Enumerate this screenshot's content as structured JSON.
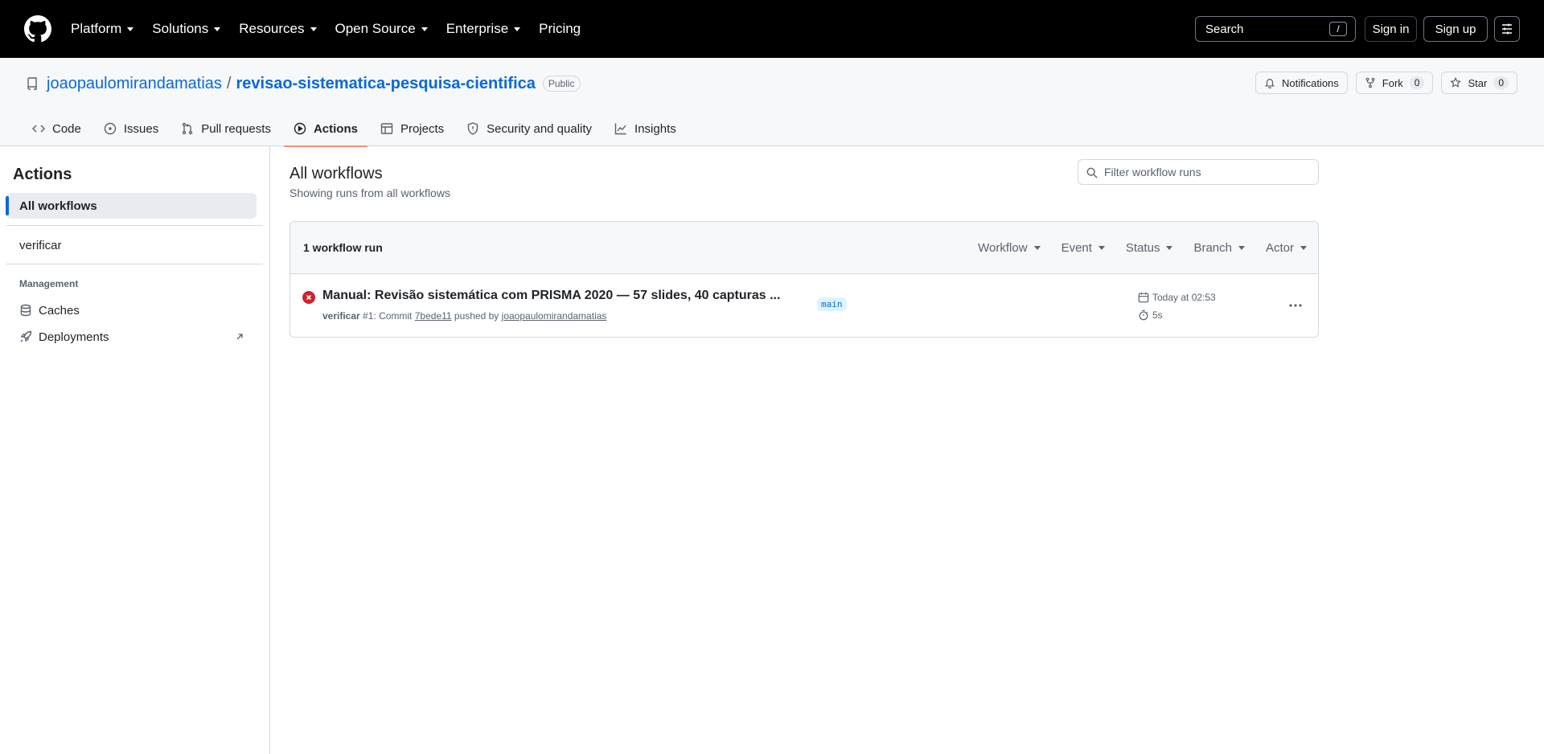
{
  "header": {
    "nav": [
      {
        "label": "Platform"
      },
      {
        "label": "Solutions"
      },
      {
        "label": "Resources"
      },
      {
        "label": "Open Source"
      },
      {
        "label": "Enterprise"
      },
      {
        "label": "Pricing"
      }
    ],
    "search_label": "Search",
    "search_shortcut": "/",
    "sign_in": "Sign in",
    "sign_up": "Sign up"
  },
  "repo": {
    "owner": "joaopaulomirandamatias",
    "separator": "/",
    "name": "revisao-sistematica-pesquisa-cientifica",
    "visibility": "Public",
    "notifications_label": "Notifications",
    "fork_label": "Fork",
    "fork_count": "0",
    "star_label": "Star",
    "star_count": "0",
    "tabs": [
      {
        "label": "Code",
        "icon": "code-icon"
      },
      {
        "label": "Issues",
        "icon": "issue-icon"
      },
      {
        "label": "Pull requests",
        "icon": "pull-request-icon"
      },
      {
        "label": "Actions",
        "icon": "play-icon",
        "selected": true
      },
      {
        "label": "Projects",
        "icon": "table-icon"
      },
      {
        "label": "Security and quality",
        "icon": "shield-icon"
      },
      {
        "label": "Insights",
        "icon": "graph-icon"
      }
    ]
  },
  "sidebar": {
    "title": "Actions",
    "all_workflows": "All workflows",
    "workflows": [
      "verificar"
    ],
    "management_heading": "Management",
    "caches": "Caches",
    "deployments": "Deployments"
  },
  "main": {
    "title": "All workflows",
    "subtitle": "Showing runs from all workflows",
    "filter_placeholder": "Filter workflow runs",
    "runs_count": "1 workflow run",
    "filters": [
      "Workflow",
      "Event",
      "Status",
      "Branch",
      "Actor"
    ],
    "runs": [
      {
        "status": "failure",
        "title": "Manual: Revisão sistemática com PRISMA 2020 — 57 slides, 40 capturas ...",
        "workflow": "verificar",
        "run_text": "#1: Commit",
        "commit": "7bede11",
        "pushed_by": "pushed by",
        "actor": "joaopaulomirandamatias",
        "branch": "main",
        "date": "Today at 02:53",
        "duration": "5s"
      }
    ]
  },
  "colors": {
    "header_bg": "#000000",
    "link": "#0969da",
    "selected_tab_underline": "#fd8c73",
    "failure": "#cf222e",
    "branch_bg": "#ddf4ff"
  }
}
